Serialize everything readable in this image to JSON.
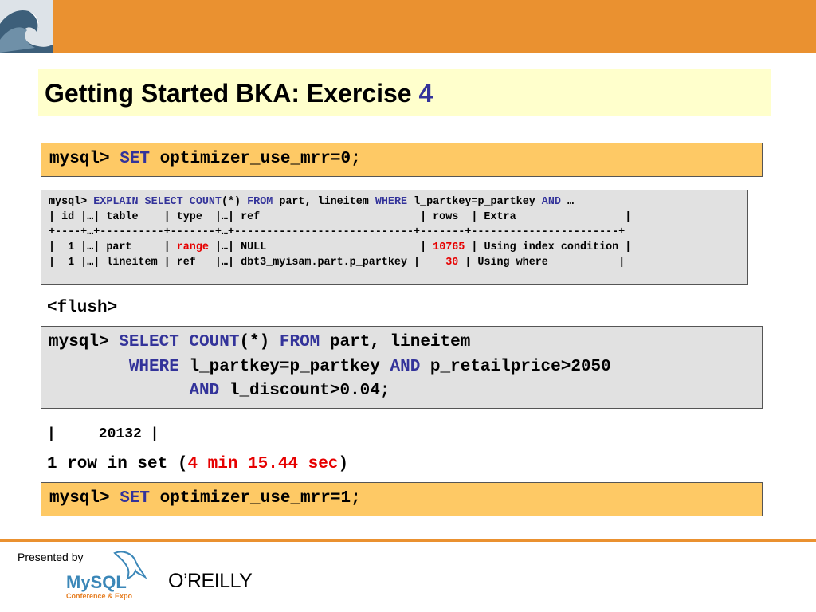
{
  "slide": {
    "title_main": "Getting Started BKA: Exercise ",
    "title_num": "4",
    "colors": {
      "header_bar": "#ea9130",
      "accent": "#33339a",
      "highlight": "#e60000",
      "title_bg": "#ffffcc",
      "code_orange": "#fec965",
      "code_gray": "#e1e1e1"
    }
  },
  "code1": {
    "prompt": "mysql> ",
    "kw": "SET",
    "rest": " optimizer_use_mrr=0;"
  },
  "explain": {
    "l1_prompt": "mysql> ",
    "l1_kw1": "EXPLAIN SELECT COUNT",
    "l1_t1": "(*) ",
    "l1_kw2": "FROM",
    "l1_t2": " part, lineitem ",
    "l1_kw3": "WHERE",
    "l1_t3": " l_partkey=p_partkey ",
    "l1_kw4": "AND",
    "l1_t4": " …",
    "header": "| id |…| table    | type  |…| ref                         | rows  | Extra                 |",
    "sep": "+----+…+----------+-------+…+----------------------------+-------+-----------------------+",
    "r1_a": "|  1 |…| part     | ",
    "r1_type": "range",
    "r1_b": " |…| NULL                        | ",
    "r1_rows": "10765",
    "r1_c": " | Using index condition |",
    "r2_a": "|  1 |…| lineitem | ref   |…| dbt3_myisam.part.p_partkey |    ",
    "r2_rows": "30",
    "r2_c": " | Using where           |"
  },
  "flush": "<flush>",
  "query": {
    "l1_prompt": "mysql> ",
    "l1_kw1": "SELECT COUNT",
    "l1_t1": "(*) ",
    "l1_kw2": "FROM",
    "l1_t2": " part, lineitem",
    "l2_indent": "        ",
    "l2_kw": "WHERE",
    "l2_t": " l_partkey=p_partkey ",
    "l2_kw2": "AND",
    "l2_t2": " p_retailprice>2050",
    "l3_indent": "              ",
    "l3_kw": "AND",
    "l3_t": " l_discount>0.04;"
  },
  "result": "|     20132 |",
  "rowset": {
    "pre": "1 row in set (",
    "time": "4 min 15.44 sec",
    "post": ")"
  },
  "code2": {
    "prompt": "mysql> ",
    "kw": "SET",
    "rest": " optimizer_use_mrr=1;"
  },
  "footer": {
    "presented_by": "Presented by",
    "mysql_logo": "MySQL",
    "mysql_sub": "Conference & Expo",
    "oreilly": "O’REILLY"
  }
}
